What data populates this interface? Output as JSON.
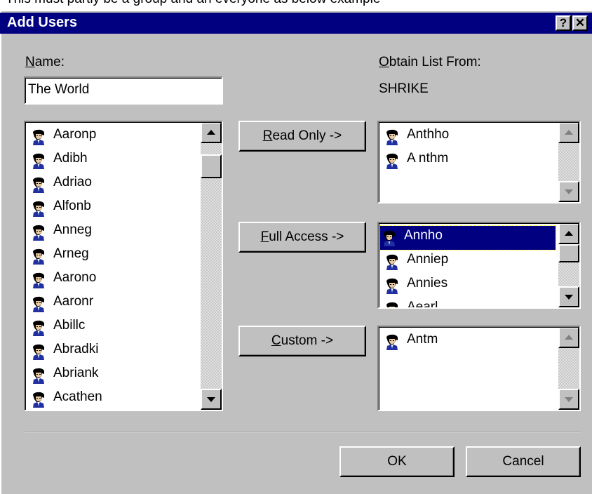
{
  "top_strip_text": "This must partly be a group and an everyone as below example",
  "dialog": {
    "title": "Add Users",
    "help_button": "?",
    "close_button": "✕"
  },
  "name": {
    "label_mnemonic": "N",
    "label_rest": "ame:",
    "value": "The World"
  },
  "obtain": {
    "label_mnemonic": "O",
    "label_rest": "btain List From:",
    "source": "SHRIKE"
  },
  "available_users": [
    "Aaronp",
    "Adibh",
    "Adriao",
    "Alfonb",
    "Anneg",
    "Arneg",
    "Aarono",
    "Aaronr",
    "Abillc",
    "Abradki",
    "Abriank",
    "Acathen"
  ],
  "buttons": {
    "read_only_mnemonic": "R",
    "read_only_rest": "ead Only ->",
    "full_access_mnemonic": "F",
    "full_access_rest": "ull Access ->",
    "custom_mnemonic": "C",
    "custom_rest": "ustom ->",
    "ok": "OK",
    "cancel": "Cancel"
  },
  "read_only_users": [
    "Anthho",
    "A nthm"
  ],
  "full_access_users": [
    "Annho",
    "Anniep",
    "Annies",
    "Aearl"
  ],
  "full_access_selected": "Annho",
  "custom_users": [
    "Antm"
  ],
  "colors": {
    "dialog_bg": "#c0c0c0",
    "titlebar": "#000080",
    "selection": "#000080"
  },
  "icons": {
    "user": "user-icon",
    "scroll_up": "arrow-up-icon",
    "scroll_down": "arrow-down-icon"
  }
}
